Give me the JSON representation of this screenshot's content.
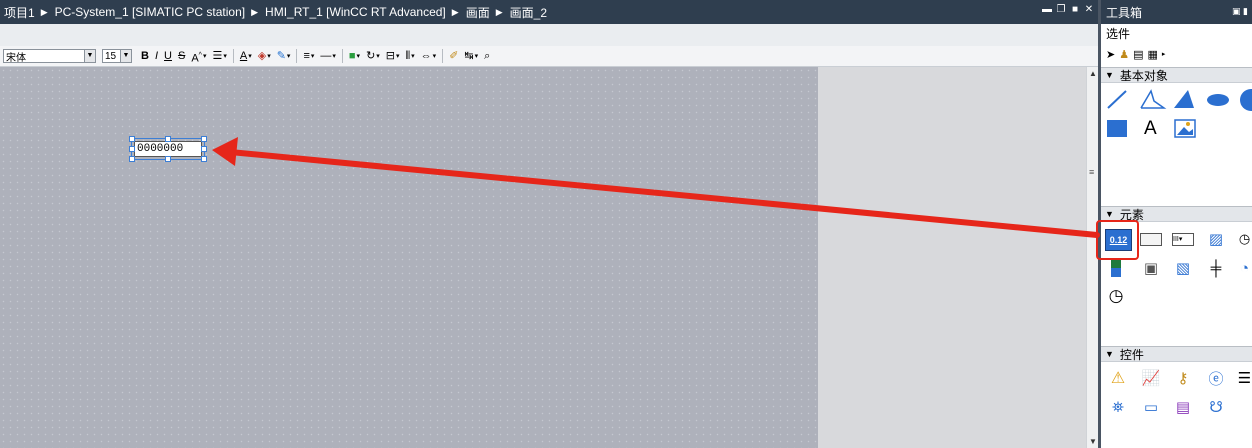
{
  "breadcrumb": [
    "项目1",
    "PC-System_1 [SIMATIC PC station]",
    "HMI_RT_1 [WinCC RT Advanced]",
    "画面",
    "画面_2"
  ],
  "window_controls": [
    "minimize-icon",
    "restore-icon",
    "maximize-icon",
    "close-icon"
  ],
  "format_toolbar": {
    "font_name": "宋体",
    "font_size": "15",
    "bold": "B",
    "italic": "I",
    "underline": "U",
    "strikethrough": "S",
    "font_size_up": "A",
    "text_color_glyph": "A"
  },
  "io_field": {
    "value": "0000000"
  },
  "toolbox": {
    "title": "工具箱",
    "selection_title": "选件",
    "basic_objects_title": "基本对象",
    "basic_objects_text_icon": "A",
    "elements_title": "元素",
    "io_field_icon_label": "0.12",
    "controls_title": "控件"
  },
  "colors": {
    "titlebar": "#2f3e4f",
    "canvas": "#aeb1bb",
    "annotation_arrow": "#e6261a",
    "selection": "#3d7fd6"
  }
}
